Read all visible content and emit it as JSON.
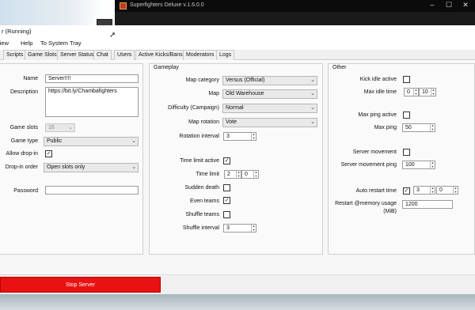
{
  "game_window": {
    "title": "Superfighters Deluxe v.1.6.0.0",
    "min": "–",
    "max": "☐",
    "close": "✕"
  },
  "app": {
    "title": "r (Running)"
  },
  "menu": [
    "view",
    "Help",
    "To System Tray"
  ],
  "tabs": [
    "Scripts",
    "Game Slots",
    "Server Status",
    "Chat",
    "Users",
    "Active Kicks/Bans",
    "Moderators",
    "Logs"
  ],
  "left": {
    "name_label": "Name",
    "name_value": "Server!!!!",
    "description_label": "Description",
    "description_value": "https://bit.ly/Chambafighters",
    "game_slots_label": "Game slots",
    "game_slots_value": "16",
    "game_type_label": "Game type",
    "game_type_value": "Public",
    "allow_dropin_label": "Allow drop-in",
    "allow_dropin_checked": true,
    "dropin_order_label": "Drop-in order",
    "dropin_order_value": "Open slots only",
    "password_label": "Password",
    "password_value": ""
  },
  "gameplay": {
    "title": "Gameplay",
    "map_category_label": "Map category",
    "map_category_value": "Versus (Official)",
    "map_label": "Map",
    "map_value": "Old Warehouse",
    "difficulty_label": "Difficulty (Campaign)",
    "difficulty_value": "Normal",
    "map_rotation_label": "Map rotation",
    "map_rotation_value": "Vote",
    "rotation_interval_label": "Rotation interval",
    "rotation_interval_value": "3",
    "time_limit_active_label": "Time limit active",
    "time_limit_active_checked": true,
    "time_limit_label": "Time limit",
    "time_limit_min": "2",
    "time_limit_sec": "0",
    "sudden_death_label": "Sudden death",
    "sudden_death_checked": false,
    "even_teams_label": "Even teams",
    "even_teams_checked": true,
    "shuffle_teams_label": "Shuffle teams",
    "shuffle_teams_checked": false,
    "shuffle_interval_label": "Shuffle interval",
    "shuffle_interval_value": "3"
  },
  "other": {
    "title": "Other",
    "kick_idle_active_label": "Kick idle active",
    "kick_idle_active_checked": false,
    "max_idle_time_label": "Max idle time",
    "max_idle_min": "0",
    "max_idle_sec": "10",
    "max_ping_active_label": "Max ping active",
    "max_ping_active_checked": false,
    "max_ping_label": "Max ping",
    "max_ping_value": "50",
    "server_movement_label": "Server movement",
    "server_movement_checked": false,
    "server_movement_ping_label": "Server movement ping",
    "server_movement_ping_value": "100",
    "auto_restart_label": "Auto restart time",
    "auto_restart_checked": true,
    "auto_restart_h": "3",
    "auto_restart_m": "0",
    "restart_memory_label_1": "Restart @memory usage",
    "restart_memory_label_2": "(MiB)",
    "restart_memory_value": "1200"
  },
  "stop_button": "Stop Server"
}
